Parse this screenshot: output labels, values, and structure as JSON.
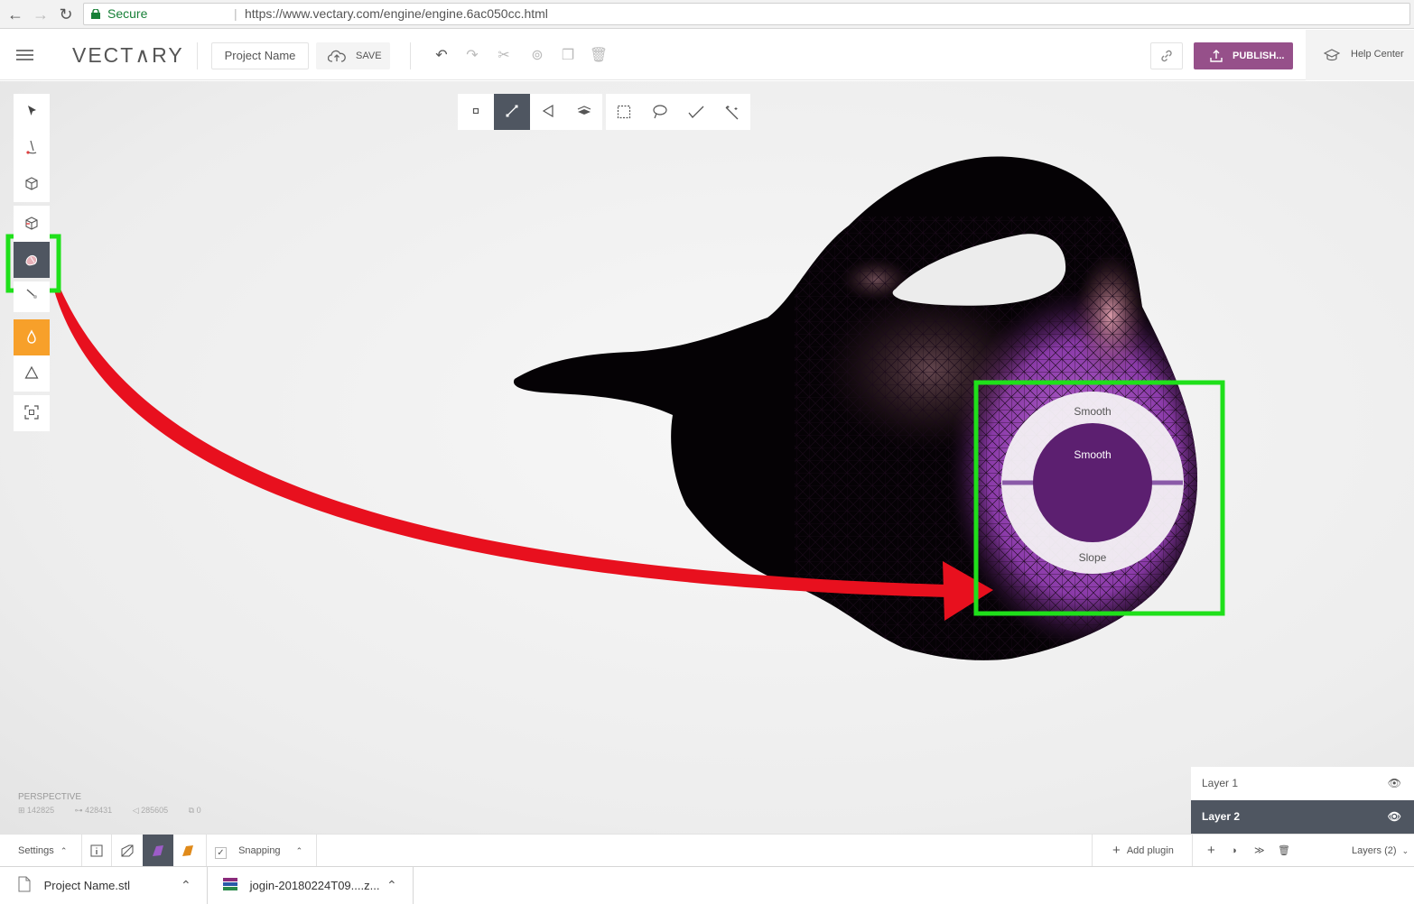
{
  "browser": {
    "secure_label": "Secure",
    "url": "https://www.vectary.com/engine/engine.6ac050cc.html"
  },
  "header": {
    "logo": "VECT∧RY",
    "project_name": "Project Name",
    "save_label": "SAVE",
    "publish_label": "PUBLISH...",
    "help_label": "Help Center"
  },
  "viewport": {
    "camera_label": "PERSPECTIVE",
    "stats": [
      "142825",
      "428431",
      "285605",
      "0"
    ]
  },
  "radial_menu": {
    "top_label": "Smooth",
    "center_label": "Smooth",
    "bottom_label": "Slope"
  },
  "layers_panel": {
    "items": [
      {
        "label": "Layer 1",
        "selected": false
      },
      {
        "label": "Layer 2",
        "selected": true
      }
    ]
  },
  "bottom_toolbar": {
    "settings_label": "Settings",
    "snapping_label": "Snapping",
    "add_plugin_label": "Add plugin",
    "layers_label": "Layers (2)"
  },
  "downloads": [
    {
      "name": "Project Name.stl"
    },
    {
      "name": "jogin-20180224T09....z..."
    }
  ],
  "colors": {
    "accent_purple": "#96508a",
    "active_tool": "#4f5661",
    "orange_tool": "#f7a02a",
    "highlight_green": "#1fe01a",
    "arrow_red": "#e8101e"
  }
}
